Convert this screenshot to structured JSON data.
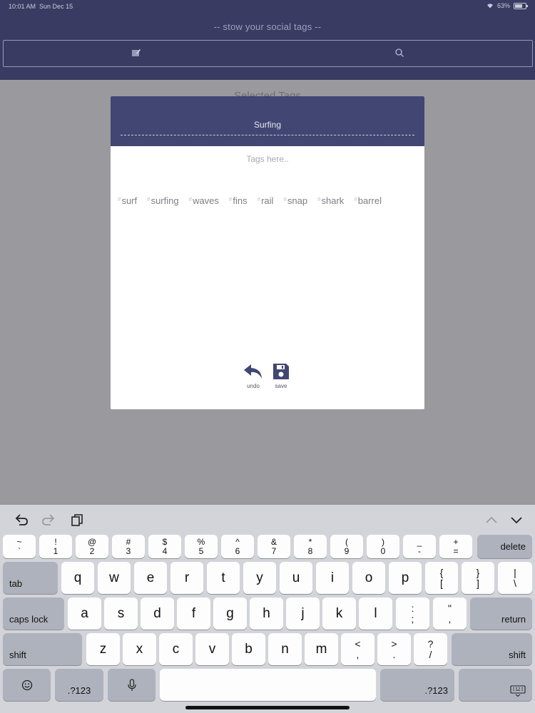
{
  "status_bar": {
    "time": "10:01 AM",
    "date": "Sun Dec 15",
    "battery": "63%"
  },
  "header": {
    "title": "-- stow your social tags --"
  },
  "background": {
    "label": "Selected Tags"
  },
  "modal": {
    "title": "Surfing",
    "input_placeholder": "Tags here..",
    "tags": [
      "surf",
      "surfing",
      "waves",
      "fins",
      "rail",
      "snap",
      "shark",
      "barrel"
    ],
    "hash_symbol": "#",
    "undo_label": "undo",
    "save_label": "save"
  },
  "keyboard": {
    "number_row": [
      {
        "top": "~",
        "bottom": "`"
      },
      {
        "top": "!",
        "bottom": "1"
      },
      {
        "top": "@",
        "bottom": "2"
      },
      {
        "top": "#",
        "bottom": "3"
      },
      {
        "top": "$",
        "bottom": "4"
      },
      {
        "top": "%",
        "bottom": "5"
      },
      {
        "top": "^",
        "bottom": "6"
      },
      {
        "top": "&",
        "bottom": "7"
      },
      {
        "top": "*",
        "bottom": "8"
      },
      {
        "top": "(",
        "bottom": "9"
      },
      {
        "top": ")",
        "bottom": "0"
      },
      {
        "top": "_",
        "bottom": "-"
      },
      {
        "top": "+",
        "bottom": "="
      }
    ],
    "delete": "delete",
    "tab": "tab",
    "row1": [
      "q",
      "w",
      "e",
      "r",
      "t",
      "y",
      "u",
      "i",
      "o",
      "p"
    ],
    "row1_sym": [
      {
        "top": "{",
        "bottom": "["
      },
      {
        "top": "}",
        "bottom": "]"
      },
      {
        "top": "|",
        "bottom": "\\"
      }
    ],
    "caps_lock": "caps lock",
    "row2": [
      "a",
      "s",
      "d",
      "f",
      "g",
      "h",
      "j",
      "k",
      "l"
    ],
    "row2_sym": [
      {
        "top": ":",
        "bottom": ";"
      },
      {
        "top": "\"",
        "bottom": ","
      }
    ],
    "return": "return",
    "shift_left": "shift",
    "row3": [
      "z",
      "x",
      "c",
      "v",
      "b",
      "n",
      "m"
    ],
    "row3_sym": [
      {
        "top": "<",
        "bottom": ","
      },
      {
        "top": ">",
        "bottom": "."
      },
      {
        "top": "?",
        "bottom": "/"
      }
    ],
    "shift_right": "shift",
    "num_left": ".?123",
    "num_right": ".?123"
  }
}
